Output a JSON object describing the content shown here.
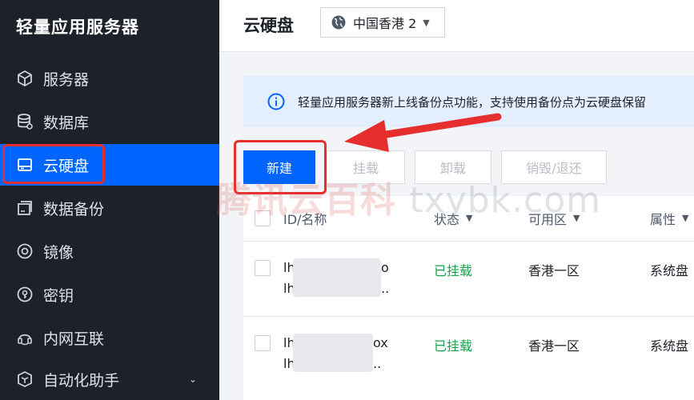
{
  "sidebar": {
    "title": "轻量应用服务器",
    "items": [
      {
        "label": "服务器",
        "icon": "cube-icon"
      },
      {
        "label": "数据库",
        "icon": "database-icon"
      },
      {
        "label": "云硬盘",
        "icon": "disk-icon",
        "active": true
      },
      {
        "label": "数据备份",
        "icon": "backup-icon"
      },
      {
        "label": "镜像",
        "icon": "image-icon"
      },
      {
        "label": "密钥",
        "icon": "key-icon"
      },
      {
        "label": "内网互联",
        "icon": "network-icon"
      },
      {
        "label": "自动化助手",
        "icon": "automation-icon",
        "chevron": "⌄"
      }
    ]
  },
  "header": {
    "title": "云硬盘",
    "region": "中国香港 2",
    "region_caret": "▼"
  },
  "notice": {
    "text": "轻量应用服务器新上线备份点功能，支持使用备份点为云硬盘保留"
  },
  "toolbar": {
    "new_label": "新建",
    "mount_label": "挂载",
    "unmount_label": "卸载",
    "destroy_label": "销毁/退还"
  },
  "table": {
    "headers": {
      "id": "ID/名称",
      "status": "状态",
      "zone": "可用区",
      "attr": "属性"
    },
    "rows": [
      {
        "id_line1": "lh",
        "id_tail1": "o",
        "id_line2": "lh",
        "id_tail2": "..",
        "status": "已挂载",
        "zone": "香港一区",
        "attr": "系统盘"
      },
      {
        "id_line1": "lh",
        "id_tail1": "ox",
        "id_line2": "lh",
        "id_tail2": "..",
        "status": "已挂载",
        "zone": "香港一区",
        "attr": "系统盘"
      }
    ]
  },
  "watermark": {
    "cn": "腾讯云百科",
    "domain": "txybk.com"
  },
  "colors": {
    "sidebar_bg": "#1d2129",
    "accent": "#0065ff",
    "highlight": "#e62e2e",
    "status_green": "#17a34a",
    "notice_bg": "#e3eefe"
  }
}
